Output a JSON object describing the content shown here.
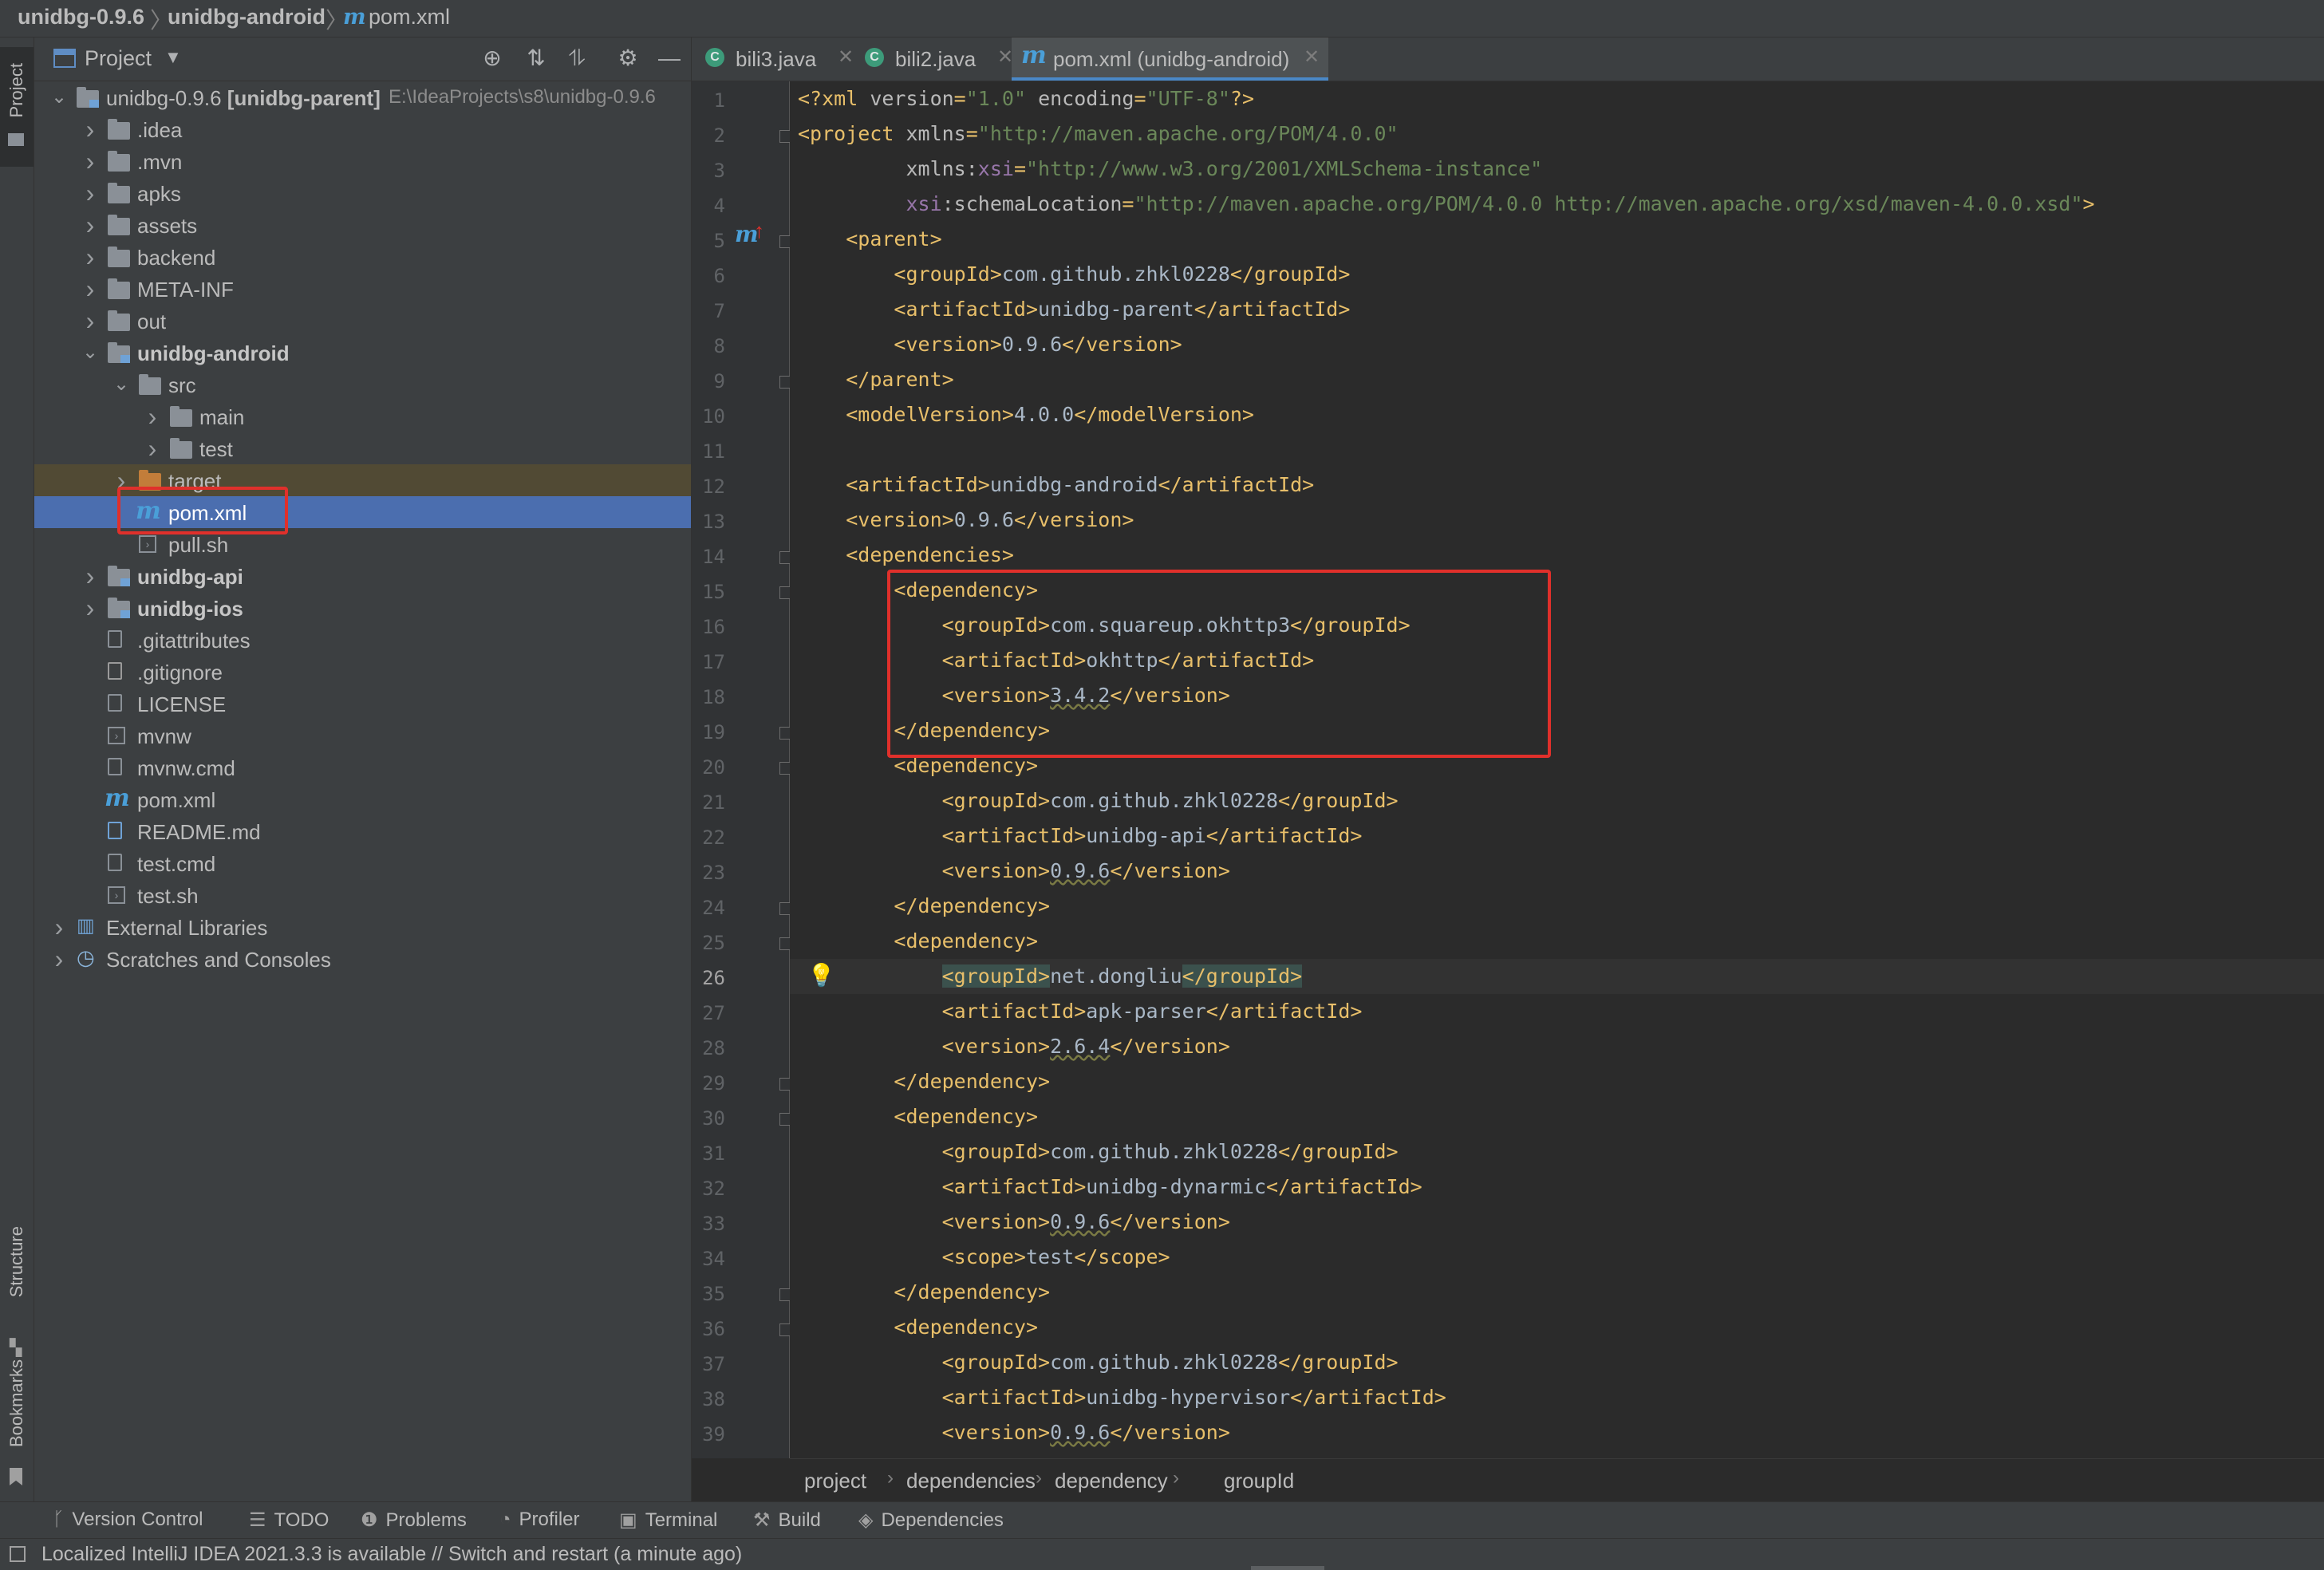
{
  "breadcrumb": [
    "unidbg-0.9.6",
    "unidbg-android",
    "pom.xml"
  ],
  "left_strip": {
    "project": "Project",
    "structure": "Structure",
    "bookmarks": "Bookmarks"
  },
  "project_panel": {
    "title": "Project",
    "tree": [
      {
        "label": "unidbg-0.9.6 [unidbg-parent]",
        "path": "E:\\IdeaProjects\\s8\\unidbg-0.9.6",
        "depth": 0,
        "expanded": true,
        "icon": "module-folder-icon"
      },
      {
        "label": ".idea",
        "depth": 1,
        "expanded": false,
        "icon": "folder-icon"
      },
      {
        "label": ".mvn",
        "depth": 1,
        "expanded": false,
        "icon": "folder-icon"
      },
      {
        "label": "apks",
        "depth": 1,
        "expanded": false,
        "icon": "folder-icon"
      },
      {
        "label": "assets",
        "depth": 1,
        "expanded": false,
        "icon": "folder-icon"
      },
      {
        "label": "backend",
        "depth": 1,
        "expanded": false,
        "icon": "folder-icon"
      },
      {
        "label": "META-INF",
        "depth": 1,
        "expanded": false,
        "icon": "folder-icon"
      },
      {
        "label": "out",
        "depth": 1,
        "expanded": false,
        "icon": "folder-icon"
      },
      {
        "label": "unidbg-android",
        "depth": 1,
        "expanded": true,
        "icon": "module-folder-icon",
        "bold": true
      },
      {
        "label": "src",
        "depth": 2,
        "expanded": true,
        "icon": "folder-icon"
      },
      {
        "label": "main",
        "depth": 3,
        "expanded": false,
        "icon": "folder-icon"
      },
      {
        "label": "test",
        "depth": 3,
        "expanded": false,
        "icon": "folder-icon"
      },
      {
        "label": "target",
        "depth": 2,
        "expanded": false,
        "icon": "excluded-folder-icon"
      },
      {
        "label": "pom.xml",
        "depth": 2,
        "icon": "maven-icon",
        "selected": true
      },
      {
        "label": "pull.sh",
        "depth": 2,
        "icon": "shell-script-icon"
      },
      {
        "label": "unidbg-api",
        "depth": 1,
        "expanded": false,
        "icon": "module-folder-icon",
        "bold": true
      },
      {
        "label": "unidbg-ios",
        "depth": 1,
        "expanded": false,
        "icon": "module-folder-icon",
        "bold": true
      },
      {
        "label": ".gitattributes",
        "depth": 1,
        "icon": "text-file-icon"
      },
      {
        "label": ".gitignore",
        "depth": 1,
        "icon": "gitignore-icon"
      },
      {
        "label": "LICENSE",
        "depth": 1,
        "icon": "text-file-icon"
      },
      {
        "label": "mvnw",
        "depth": 1,
        "icon": "shell-script-icon"
      },
      {
        "label": "mvnw.cmd",
        "depth": 1,
        "icon": "text-file-icon"
      },
      {
        "label": "pom.xml",
        "depth": 1,
        "icon": "maven-icon"
      },
      {
        "label": "README.md",
        "depth": 1,
        "icon": "markdown-icon"
      },
      {
        "label": "test.cmd",
        "depth": 1,
        "icon": "text-file-icon"
      },
      {
        "label": "test.sh",
        "depth": 1,
        "icon": "shell-script-icon"
      },
      {
        "label": "External Libraries",
        "depth": 0,
        "expanded": false,
        "icon": "libraries-icon"
      },
      {
        "label": "Scratches and Consoles",
        "depth": 0,
        "expanded": false,
        "icon": "scratches-icon"
      }
    ]
  },
  "tabs": [
    {
      "label": "bili3.java",
      "icon": "java-class-icon",
      "active": false
    },
    {
      "label": "bili2.java",
      "icon": "java-class-icon",
      "active": false
    },
    {
      "label": "pom.xml (unidbg-android)",
      "icon": "maven-icon",
      "active": true
    }
  ],
  "editor": {
    "current_line": 26,
    "lines": [
      [
        [
          "t",
          "<?xml "
        ],
        [
          "a",
          "version"
        ],
        [
          "t",
          "="
        ],
        [
          "v",
          "\"1.0\""
        ],
        [
          "t",
          " "
        ],
        [
          "a",
          "encoding"
        ],
        [
          "t",
          "="
        ],
        [
          "v",
          "\"UTF-8\""
        ],
        [
          "t",
          "?>"
        ]
      ],
      [
        [
          "t",
          "<project "
        ],
        [
          "a",
          "xmlns"
        ],
        [
          "t",
          "="
        ],
        [
          "v",
          "\"http://maven.apache.org/POM/4.0.0\""
        ]
      ],
      [
        [
          "x",
          "         "
        ],
        [
          "a",
          "xmlns:"
        ],
        [
          "n",
          "xsi"
        ],
        [
          "t",
          "="
        ],
        [
          "v",
          "\"http://www.w3.org/2001/XMLSchema-instance\""
        ]
      ],
      [
        [
          "x",
          "         "
        ],
        [
          "n",
          "xsi"
        ],
        [
          "a",
          ":schemaLocation"
        ],
        [
          "t",
          "="
        ],
        [
          "v",
          "\"http://maven.apache.org/POM/4.0.0 http://maven.apache.org/xsd/maven-4.0.0.xsd\""
        ],
        [
          "t",
          ">"
        ]
      ],
      [
        [
          "x",
          "    "
        ],
        [
          "t",
          "<parent>"
        ]
      ],
      [
        [
          "x",
          "        "
        ],
        [
          "t",
          "<groupId>"
        ],
        [
          "x",
          "com.github.zhkl0228"
        ],
        [
          "t",
          "</groupId>"
        ]
      ],
      [
        [
          "x",
          "        "
        ],
        [
          "t",
          "<artifactId>"
        ],
        [
          "x",
          "unidbg-parent"
        ],
        [
          "t",
          "</artifactId>"
        ]
      ],
      [
        [
          "x",
          "        "
        ],
        [
          "t",
          "<version>"
        ],
        [
          "x",
          "0.9.6"
        ],
        [
          "t",
          "</version>"
        ]
      ],
      [
        [
          "x",
          "    "
        ],
        [
          "t",
          "</parent>"
        ]
      ],
      [
        [
          "x",
          "    "
        ],
        [
          "t",
          "<modelVersion>"
        ],
        [
          "x",
          "4.0.0"
        ],
        [
          "t",
          "</modelVersion>"
        ]
      ],
      [],
      [
        [
          "x",
          "    "
        ],
        [
          "t",
          "<artifactId>"
        ],
        [
          "x",
          "unidbg-android"
        ],
        [
          "t",
          "</artifactId>"
        ]
      ],
      [
        [
          "x",
          "    "
        ],
        [
          "t",
          "<version>"
        ],
        [
          "x",
          "0.9.6"
        ],
        [
          "t",
          "</version>"
        ]
      ],
      [
        [
          "x",
          "    "
        ],
        [
          "t",
          "<dependencies>"
        ]
      ],
      [
        [
          "x",
          "        "
        ],
        [
          "t",
          "<dependency>"
        ]
      ],
      [
        [
          "x",
          "            "
        ],
        [
          "t",
          "<groupId>"
        ],
        [
          "x",
          "com.squareup.okhttp3"
        ],
        [
          "t",
          "</groupId>"
        ]
      ],
      [
        [
          "x",
          "            "
        ],
        [
          "t",
          "<artifactId>"
        ],
        [
          "x",
          "okhttp"
        ],
        [
          "t",
          "</artifactId>"
        ]
      ],
      [
        [
          "x",
          "            "
        ],
        [
          "t",
          "<version>"
        ],
        [
          "w",
          "3.4.2"
        ],
        [
          "t",
          "</version>"
        ]
      ],
      [
        [
          "x",
          "        "
        ],
        [
          "t",
          "</dependency>"
        ]
      ],
      [
        [
          "x",
          "        "
        ],
        [
          "t",
          "<dependency>"
        ]
      ],
      [
        [
          "x",
          "            "
        ],
        [
          "t",
          "<groupId>"
        ],
        [
          "x",
          "com.github.zhkl0228"
        ],
        [
          "t",
          "</groupId>"
        ]
      ],
      [
        [
          "x",
          "            "
        ],
        [
          "t",
          "<artifactId>"
        ],
        [
          "x",
          "unidbg-api"
        ],
        [
          "t",
          "</artifactId>"
        ]
      ],
      [
        [
          "x",
          "            "
        ],
        [
          "t",
          "<version>"
        ],
        [
          "w",
          "0.9.6"
        ],
        [
          "t",
          "</version>"
        ]
      ],
      [
        [
          "x",
          "        "
        ],
        [
          "t",
          "</dependency>"
        ]
      ],
      [
        [
          "x",
          "        "
        ],
        [
          "t",
          "<dependency>"
        ]
      ],
      [
        [
          "x",
          "            "
        ],
        [
          "h",
          "<groupId>"
        ],
        [
          "x",
          "net.dongliu"
        ],
        [
          "h",
          "</groupId>"
        ]
      ],
      [
        [
          "x",
          "            "
        ],
        [
          "t",
          "<artifactId>"
        ],
        [
          "x",
          "apk-parser"
        ],
        [
          "t",
          "</artifactId>"
        ]
      ],
      [
        [
          "x",
          "            "
        ],
        [
          "t",
          "<version>"
        ],
        [
          "w",
          "2.6.4"
        ],
        [
          "t",
          "</version>"
        ]
      ],
      [
        [
          "x",
          "        "
        ],
        [
          "t",
          "</dependency>"
        ]
      ],
      [
        [
          "x",
          "        "
        ],
        [
          "t",
          "<dependency>"
        ]
      ],
      [
        [
          "x",
          "            "
        ],
        [
          "t",
          "<groupId>"
        ],
        [
          "x",
          "com.github.zhkl0228"
        ],
        [
          "t",
          "</groupId>"
        ]
      ],
      [
        [
          "x",
          "            "
        ],
        [
          "t",
          "<artifactId>"
        ],
        [
          "x",
          "unidbg-dynarmic"
        ],
        [
          "t",
          "</artifactId>"
        ]
      ],
      [
        [
          "x",
          "            "
        ],
        [
          "t",
          "<version>"
        ],
        [
          "w",
          "0.9.6"
        ],
        [
          "t",
          "</version>"
        ]
      ],
      [
        [
          "x",
          "            "
        ],
        [
          "t",
          "<scope>"
        ],
        [
          "x",
          "test"
        ],
        [
          "t",
          "</scope>"
        ]
      ],
      [
        [
          "x",
          "        "
        ],
        [
          "t",
          "</dependency>"
        ]
      ],
      [
        [
          "x",
          "        "
        ],
        [
          "t",
          "<dependency>"
        ]
      ],
      [
        [
          "x",
          "            "
        ],
        [
          "t",
          "<groupId>"
        ],
        [
          "x",
          "com.github.zhkl0228"
        ],
        [
          "t",
          "</groupId>"
        ]
      ],
      [
        [
          "x",
          "            "
        ],
        [
          "t",
          "<artifactId>"
        ],
        [
          "x",
          "unidbg-hypervisor"
        ],
        [
          "t",
          "</artifactId>"
        ]
      ],
      [
        [
          "x",
          "            "
        ],
        [
          "t",
          "<version>"
        ],
        [
          "w",
          "0.9.6"
        ],
        [
          "t",
          "</version>"
        ]
      ]
    ]
  },
  "editor_breadcrumb": [
    "project",
    "dependencies",
    "dependency",
    "groupId"
  ],
  "tool_windows": [
    {
      "label": "Version Control",
      "icon": "git-branch-icon"
    },
    {
      "label": "TODO",
      "icon": "list-icon"
    },
    {
      "label": "Problems",
      "icon": "info-icon"
    },
    {
      "label": "Profiler",
      "icon": "profiler-icon"
    },
    {
      "label": "Terminal",
      "icon": "terminal-icon"
    },
    {
      "label": "Build",
      "icon": "hammer-icon"
    },
    {
      "label": "Dependencies",
      "icon": "layers-icon"
    }
  ],
  "status": "Localized IntelliJ IDEA 2021.3.3 is available // Switch and restart (a minute ago)",
  "colors": {
    "selection": "#4b6eaf",
    "highlight_box": "#e0302b",
    "tag": "#e8bf6a",
    "string": "#6a8759"
  }
}
